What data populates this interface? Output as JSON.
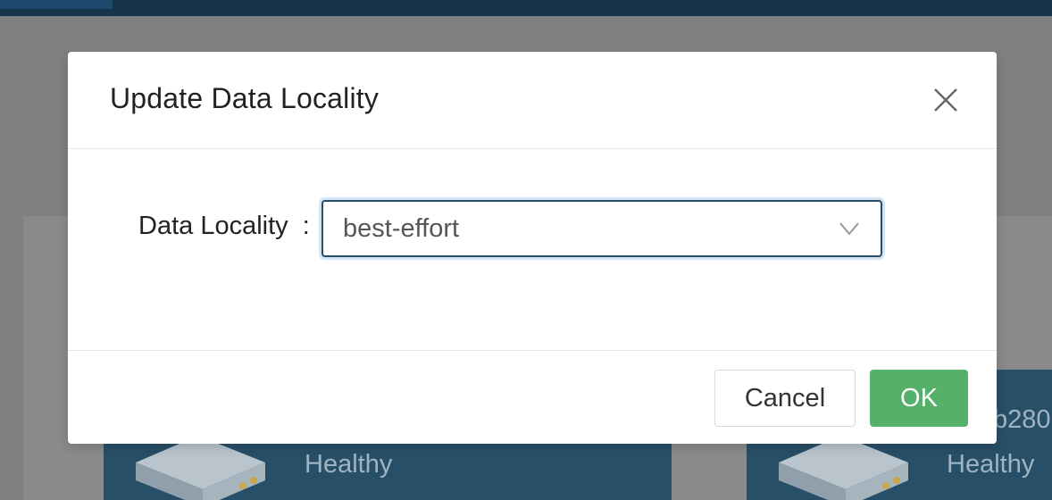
{
  "modal": {
    "title": "Update Data Locality",
    "close_icon": "close-icon",
    "field": {
      "label": "Data Locality",
      "colon": ":",
      "value": "best-effort",
      "arrow_icon": "chevron-down-icon"
    },
    "buttons": {
      "cancel": "Cancel",
      "ok": "OK"
    }
  },
  "background": {
    "cards": [
      {
        "status": "Healthy"
      },
      {
        "name_fragment": "b280",
        "status": "Healthy"
      }
    ]
  },
  "colors": {
    "topbar": "#17344d",
    "card": "#284f68",
    "primary_button": "#55b06a",
    "select_border": "#284f68"
  }
}
